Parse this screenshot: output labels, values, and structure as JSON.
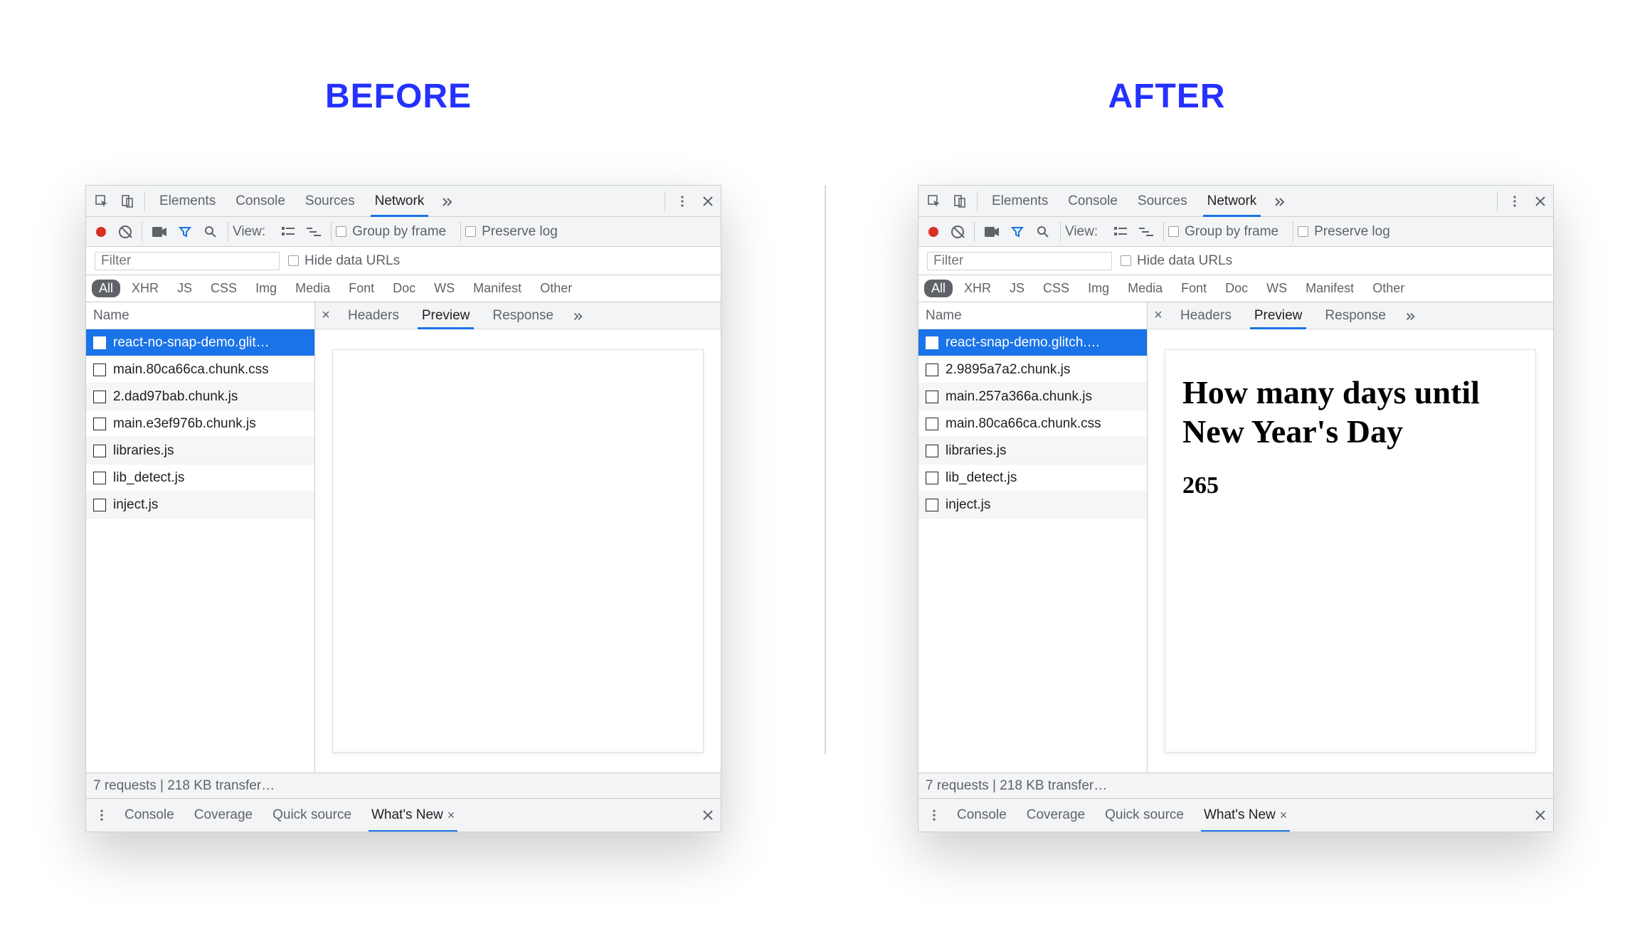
{
  "labels": {
    "before": "BEFORE",
    "after": "AFTER"
  },
  "devtools": {
    "main_tabs": {
      "elements": "Elements",
      "console": "Console",
      "sources": "Sources",
      "network": "Network"
    },
    "toolbar": {
      "view_label": "View:",
      "group_by_frame": "Group by frame",
      "preserve_log": "Preserve log"
    },
    "filter": {
      "placeholder": "Filter",
      "hide_data_urls": "Hide data URLs"
    },
    "types": [
      "All",
      "XHR",
      "JS",
      "CSS",
      "Img",
      "Media",
      "Font",
      "Doc",
      "WS",
      "Manifest",
      "Other"
    ],
    "requests_header": "Name",
    "detail_tabs": {
      "headers": "Headers",
      "preview": "Preview",
      "response": "Response"
    },
    "status": "7 requests | 218 KB transfer…",
    "drawer_tabs": {
      "console": "Console",
      "coverage": "Coverage",
      "quick_source": "Quick source",
      "whats_new": "What's New"
    }
  },
  "before_panel": {
    "selected_request": "react-no-snap-demo.glit…",
    "requests": [
      "react-no-snap-demo.glit…",
      "main.80ca66ca.chunk.css",
      "2.dad97bab.chunk.js",
      "main.e3ef976b.chunk.js",
      "libraries.js",
      "lib_detect.js",
      "inject.js"
    ],
    "preview_html_title": "",
    "preview_html_body": ""
  },
  "after_panel": {
    "selected_request": "react-snap-demo.glitch.…",
    "requests": [
      "react-snap-demo.glitch.…",
      "2.9895a7a2.chunk.js",
      "main.257a366a.chunk.js",
      "main.80ca66ca.chunk.css",
      "libraries.js",
      "lib_detect.js",
      "inject.js"
    ],
    "preview_html_title": "How many days until New Year's Day",
    "preview_html_body": "265"
  }
}
